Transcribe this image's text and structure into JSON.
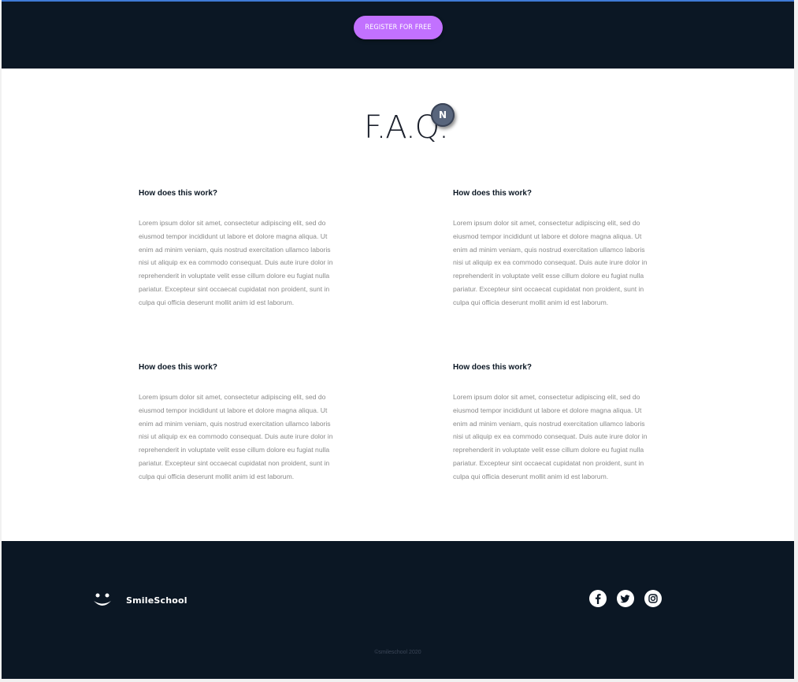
{
  "header": {
    "register_label": "Register for free"
  },
  "faq": {
    "title": "F.A.Q.",
    "badge": "N",
    "items": [
      {
        "question": "How does this work?",
        "answer": "Lorem ipsum dolor sit amet, consectetur adipiscing elit, sed do eiusmod tempor incididunt ut labore et dolore magna aliqua. Ut enim ad minim veniam, quis nostrud exercitation ullamco laboris nisi ut aliquip ex ea commodo consequat. Duis aute irure dolor in reprehenderit in voluptate velit esse cillum dolore eu fugiat nulla pariatur. Excepteur sint occaecat cupidatat non proident, sunt in culpa qui officia deserunt mollit anim id est laborum."
      },
      {
        "question": "How does this work?",
        "answer": "Lorem ipsum dolor sit amet, consectetur adipiscing elit, sed do eiusmod tempor incididunt ut labore et dolore magna aliqua. Ut enim ad minim veniam, quis nostrud exercitation ullamco laboris nisi ut aliquip ex ea commodo consequat. Duis aute irure dolor in reprehenderit in voluptate velit esse cillum dolore eu fugiat nulla pariatur. Excepteur sint occaecat cupidatat non proident, sunt in culpa qui officia deserunt mollit anim id est laborum."
      },
      {
        "question": "How does this work?",
        "answer": "Lorem ipsum dolor sit amet, consectetur adipiscing elit, sed do eiusmod tempor incididunt ut labore et dolore magna aliqua. Ut enim ad minim veniam, quis nostrud exercitation ullamco laboris nisi ut aliquip ex ea commodo consequat. Duis aute irure dolor in reprehenderit in voluptate velit esse cillum dolore eu fugiat nulla pariatur. Excepteur sint occaecat cupidatat non proident, sunt in culpa qui officia deserunt mollit anim id est laborum."
      },
      {
        "question": "How does this work?",
        "answer": "Lorem ipsum dolor sit amet, consectetur adipiscing elit, sed do eiusmod tempor incididunt ut labore et dolore magna aliqua. Ut enim ad minim veniam, quis nostrud exercitation ullamco laboris nisi ut aliquip ex ea commodo consequat. Duis aute irure dolor in reprehenderit in voluptate velit esse cillum dolore eu fugiat nulla pariatur. Excepteur sint occaecat cupidatat non proident, sunt in culpa qui officia deserunt mollit anim id est laborum."
      }
    ]
  },
  "footer": {
    "brand": "SmileSchool",
    "copyright": "©smileschool 2020",
    "social": [
      "facebook-icon",
      "twitter-icon",
      "instagram-icon"
    ]
  },
  "colors": {
    "dark_navy": "#0b1724",
    "accent_purple": "#c271ff",
    "top_line_blue": "#3f7bd6",
    "body_text_gray": "#8a8a8a"
  }
}
